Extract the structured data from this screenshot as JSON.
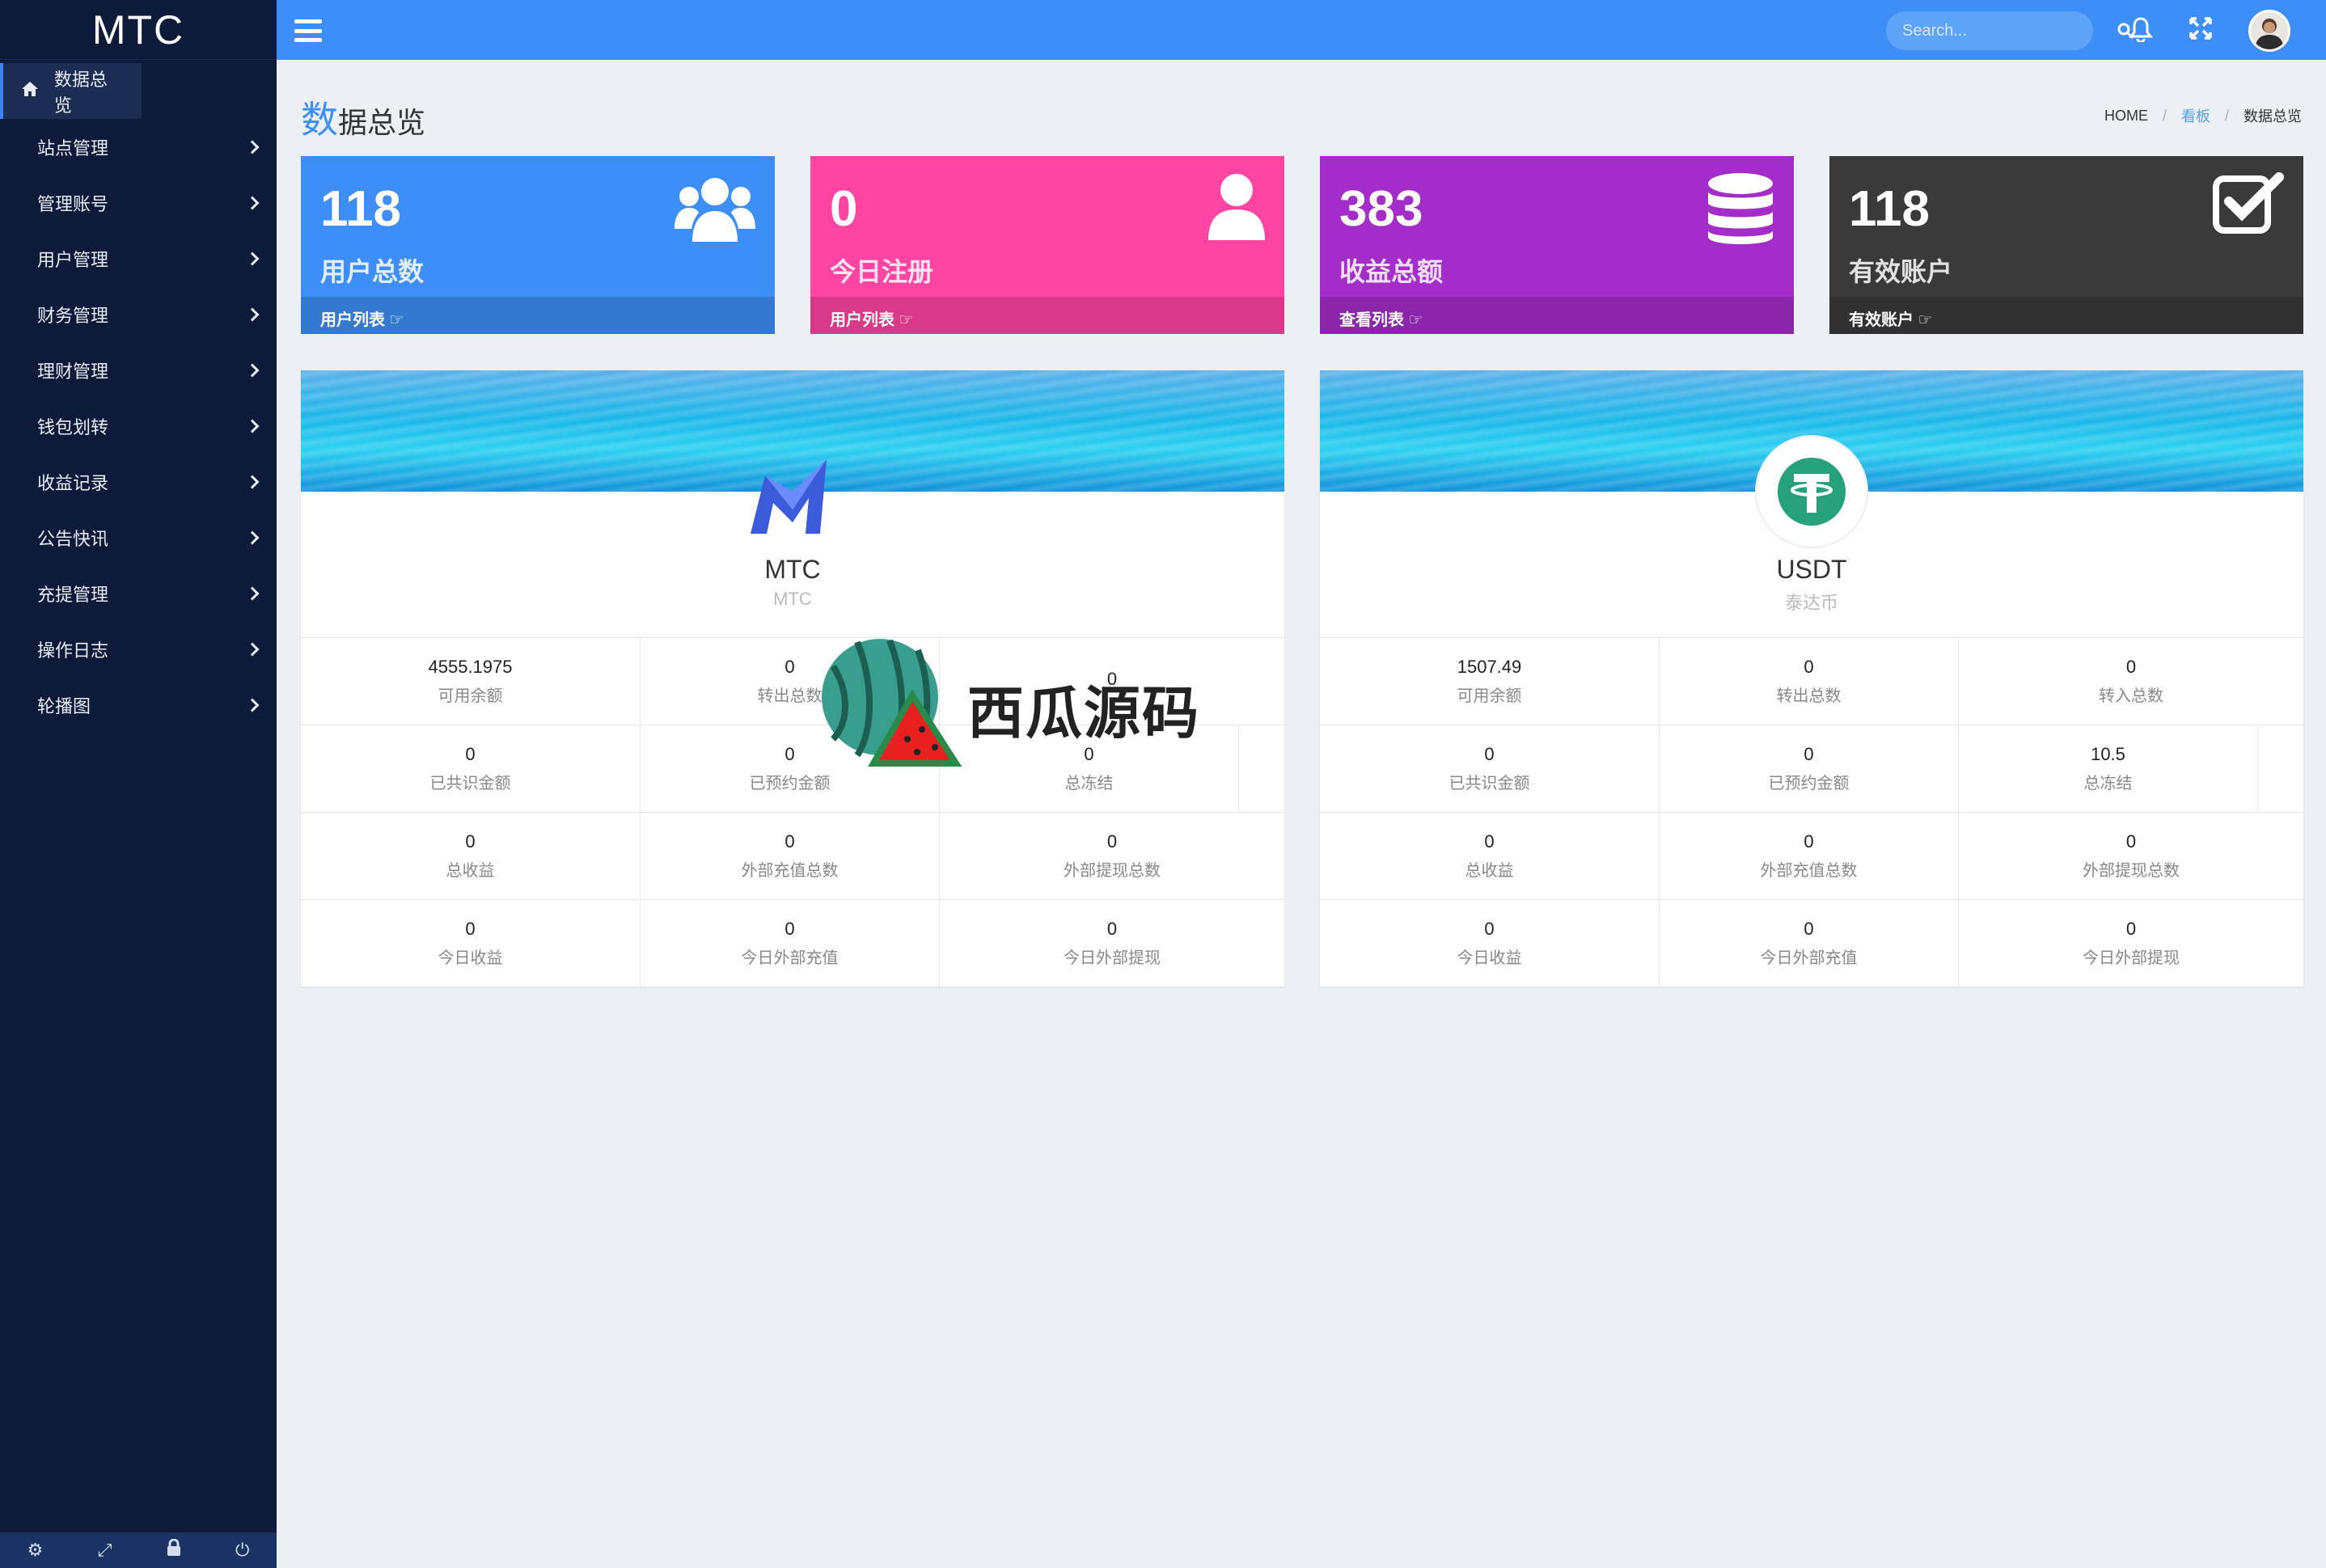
{
  "app": {
    "brand": "MTC"
  },
  "sidebar": {
    "items": [
      {
        "label": "数据总览",
        "icon": "home-icon",
        "active": true
      },
      {
        "label": "站点管理"
      },
      {
        "label": "管理账号"
      },
      {
        "label": "用户管理"
      },
      {
        "label": "财务管理"
      },
      {
        "label": "理财管理"
      },
      {
        "label": "钱包划转"
      },
      {
        "label": "收益记录"
      },
      {
        "label": "公告快讯"
      },
      {
        "label": "充提管理"
      },
      {
        "label": "操作日志"
      },
      {
        "label": "轮播图"
      }
    ],
    "footer_icons": [
      "gear-icon",
      "expand-icon",
      "lock-icon",
      "power-icon"
    ]
  },
  "topbar": {
    "search_placeholder": "Search...",
    "icons": [
      "menu-icon",
      "search-icon",
      "bell-icon",
      "fullscreen-icon",
      "avatar"
    ]
  },
  "page": {
    "title_first": "数",
    "title_rest": "据总览",
    "breadcrumb": {
      "home": "HOME",
      "section": "看板",
      "current": "数据总览"
    }
  },
  "stats": [
    {
      "value": "118",
      "label": "用户总数",
      "link": "用户列表",
      "color": "#3d8ff7",
      "icon": "users-icon"
    },
    {
      "value": "0",
      "label": "今日注册",
      "link": "用户列表",
      "color": "#ff44a2",
      "icon": "user-icon"
    },
    {
      "value": "383",
      "label": "收益总额",
      "link": "查看列表",
      "color": "#a42cc8",
      "icon": "database-icon"
    },
    {
      "value": "118",
      "label": "有效账户",
      "link": "有效账户",
      "color": "#3a3a3a",
      "icon": "check-square-icon"
    }
  ],
  "coins": [
    {
      "name": "MTC",
      "subtitle": "MTC",
      "rows": [
        [
          {
            "v": "4555.1975",
            "k": "可用余额"
          },
          {
            "v": "0",
            "k": "转出总数"
          },
          {
            "v": "0",
            "k": ""
          }
        ],
        [
          {
            "v": "0",
            "k": "已共识金额"
          },
          {
            "v": "0",
            "k": "已预约金额"
          },
          {
            "v": "0",
            "k": "总冻结"
          }
        ],
        [
          {
            "v": "0",
            "k": "总收益"
          },
          {
            "v": "0",
            "k": "外部充值总数"
          },
          {
            "v": "0",
            "k": "外部提现总数"
          }
        ],
        [
          {
            "v": "0",
            "k": "今日收益"
          },
          {
            "v": "0",
            "k": "今日外部充值"
          },
          {
            "v": "0",
            "k": "今日外部提现"
          }
        ]
      ]
    },
    {
      "name": "USDT",
      "subtitle": "泰达币",
      "rows": [
        [
          {
            "v": "1507.49",
            "k": "可用余额"
          },
          {
            "v": "0",
            "k": "转出总数"
          },
          {
            "v": "0",
            "k": "转入总数"
          }
        ],
        [
          {
            "v": "0",
            "k": "已共识金额"
          },
          {
            "v": "0",
            "k": "已预约金额"
          },
          {
            "v": "10.5",
            "k": "总冻结"
          }
        ],
        [
          {
            "v": "0",
            "k": "总收益"
          },
          {
            "v": "0",
            "k": "外部充值总数"
          },
          {
            "v": "0",
            "k": "外部提现总数"
          }
        ],
        [
          {
            "v": "0",
            "k": "今日收益"
          },
          {
            "v": "0",
            "k": "今日外部充值"
          },
          {
            "v": "0",
            "k": "今日外部提现"
          }
        ]
      ]
    }
  ],
  "watermark": {
    "text": "西瓜源码"
  }
}
